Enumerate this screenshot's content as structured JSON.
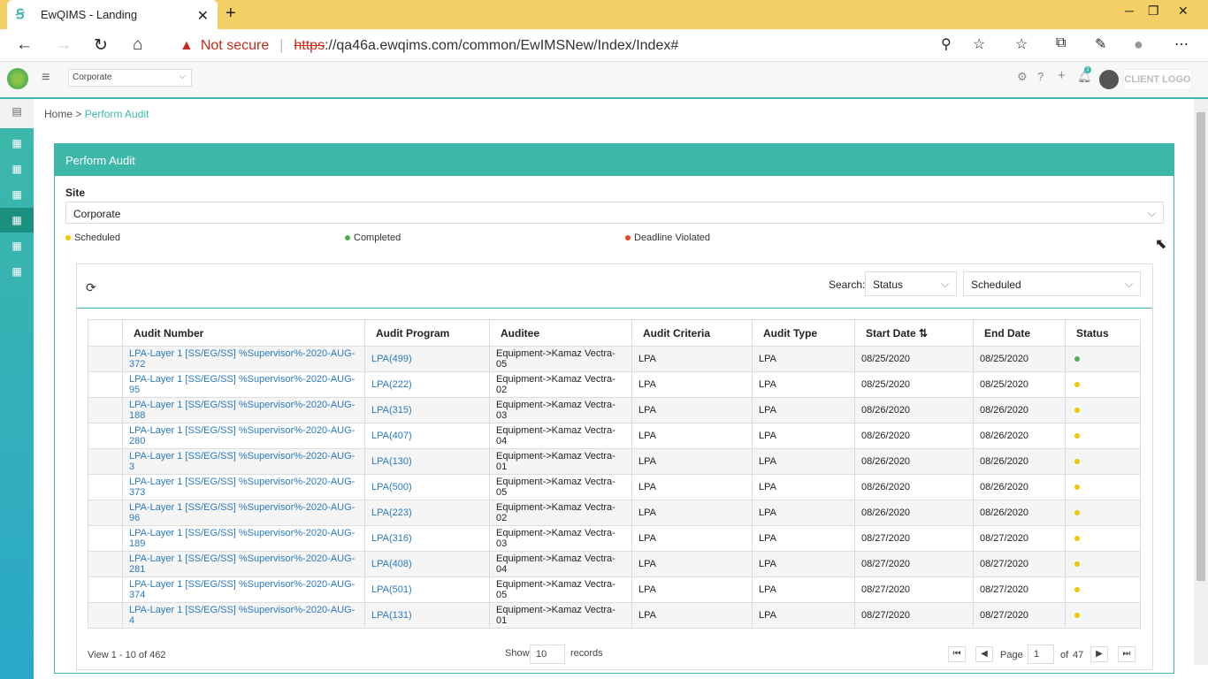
{
  "browser": {
    "tab_title": "EwQIMS - Landing",
    "not_secure": "Not secure",
    "url_https": "https",
    "url_rest": "://qa46a.ewqims.com/common/EwIMSNew/Index/Index#"
  },
  "header": {
    "org_select": "Corporate",
    "client_logo": "CLIENT LOGO",
    "notification_count": "1"
  },
  "breadcrumb": {
    "home": "Home",
    "current": "Perform Audit"
  },
  "card": {
    "title": "Perform Audit",
    "site_label": "Site",
    "site_value": "Corporate",
    "legend": {
      "scheduled": "Scheduled",
      "completed": "Completed",
      "violated": "Deadline Violated"
    }
  },
  "search": {
    "label": "Search:",
    "field": "Status",
    "value": "Scheduled"
  },
  "colors": {
    "scheduled": "#f0c800",
    "completed": "#4caf50",
    "violated": "#e64a19",
    "accent": "#3db8a8"
  },
  "columns": [
    "Audit Number",
    "Audit Program",
    "Auditee",
    "Audit Criteria",
    "Audit Type",
    "Start Date",
    "End Date",
    "Status"
  ],
  "rows": [
    {
      "num": "LPA-Layer 1 [SS/EG/SS] %Supervisor%-2020-AUG-372",
      "prog": "LPA(499)",
      "auditee": "Equipment->Kamaz Vectra-05",
      "crit": "LPA",
      "type": "LPA",
      "start": "08/25/2020",
      "end": "08/25/2020",
      "status": "completed"
    },
    {
      "num": "LPA-Layer 1 [SS/EG/SS] %Supervisor%-2020-AUG-95",
      "prog": "LPA(222)",
      "auditee": "Equipment->Kamaz Vectra-02",
      "crit": "LPA",
      "type": "LPA",
      "start": "08/25/2020",
      "end": "08/25/2020",
      "status": "scheduled"
    },
    {
      "num": "LPA-Layer 1 [SS/EG/SS] %Supervisor%-2020-AUG-188",
      "prog": "LPA(315)",
      "auditee": "Equipment->Kamaz Vectra-03",
      "crit": "LPA",
      "type": "LPA",
      "start": "08/26/2020",
      "end": "08/26/2020",
      "status": "scheduled"
    },
    {
      "num": "LPA-Layer 1 [SS/EG/SS] %Supervisor%-2020-AUG-280",
      "prog": "LPA(407)",
      "auditee": "Equipment->Kamaz Vectra-04",
      "crit": "LPA",
      "type": "LPA",
      "start": "08/26/2020",
      "end": "08/26/2020",
      "status": "scheduled"
    },
    {
      "num": "LPA-Layer 1 [SS/EG/SS] %Supervisor%-2020-AUG-3",
      "prog": "LPA(130)",
      "auditee": "Equipment->Kamaz Vectra-01",
      "crit": "LPA",
      "type": "LPA",
      "start": "08/26/2020",
      "end": "08/26/2020",
      "status": "scheduled"
    },
    {
      "num": "LPA-Layer 1 [SS/EG/SS] %Supervisor%-2020-AUG-373",
      "prog": "LPA(500)",
      "auditee": "Equipment->Kamaz Vectra-05",
      "crit": "LPA",
      "type": "LPA",
      "start": "08/26/2020",
      "end": "08/26/2020",
      "status": "scheduled"
    },
    {
      "num": "LPA-Layer 1 [SS/EG/SS] %Supervisor%-2020-AUG-96",
      "prog": "LPA(223)",
      "auditee": "Equipment->Kamaz Vectra-02",
      "crit": "LPA",
      "type": "LPA",
      "start": "08/26/2020",
      "end": "08/26/2020",
      "status": "scheduled"
    },
    {
      "num": "LPA-Layer 1 [SS/EG/SS] %Supervisor%-2020-AUG-189",
      "prog": "LPA(316)",
      "auditee": "Equipment->Kamaz Vectra-03",
      "crit": "LPA",
      "type": "LPA",
      "start": "08/27/2020",
      "end": "08/27/2020",
      "status": "scheduled"
    },
    {
      "num": "LPA-Layer 1 [SS/EG/SS] %Supervisor%-2020-AUG-281",
      "prog": "LPA(408)",
      "auditee": "Equipment->Kamaz Vectra-04",
      "crit": "LPA",
      "type": "LPA",
      "start": "08/27/2020",
      "end": "08/27/2020",
      "status": "scheduled"
    },
    {
      "num": "LPA-Layer 1 [SS/EG/SS] %Supervisor%-2020-AUG-374",
      "prog": "LPA(501)",
      "auditee": "Equipment->Kamaz Vectra-05",
      "crit": "LPA",
      "type": "LPA",
      "start": "08/27/2020",
      "end": "08/27/2020",
      "status": "scheduled"
    },
    {
      "num": "LPA-Layer 1 [SS/EG/SS] %Supervisor%-2020-AUG-4",
      "prog": "LPA(131)",
      "auditee": "Equipment->Kamaz Vectra-01",
      "crit": "LPA",
      "type": "LPA",
      "start": "08/27/2020",
      "end": "08/27/2020",
      "status": "scheduled"
    }
  ],
  "pager": {
    "view": "View 1 - 10 of 462",
    "show": "Show",
    "size": "10",
    "records": "records",
    "page_label": "Page",
    "page": "1",
    "of": "of",
    "total": "47"
  }
}
